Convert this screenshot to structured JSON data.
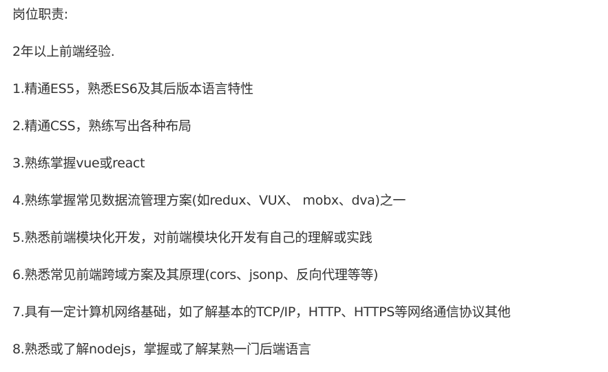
{
  "document": {
    "heading": "岗位职责:",
    "lines": [
      "2年以上前端经验.",
      "1.精通ES5，熟悉ES6及其后版本语言特性",
      "2.精通CSS，熟练写出各种布局",
      "3.熟练掌握vue或react",
      "4.熟练掌握常见数据流管理方案(如redux、VUX、 mobx、dva)之一",
      "5.熟悉前端模块化开发，对前端模块化开发有自己的理解或实践",
      "6.熟悉常见前端跨域方案及其原理(cors、jsonp、反向代理等等)",
      "7.具有一定计算机网络基础，如了解基本的TCP/IP，HTTP、HTTPS等网络通信协议其他",
      "8.熟悉或了解nodejs，掌握或了解某熟一门后端语言"
    ]
  }
}
